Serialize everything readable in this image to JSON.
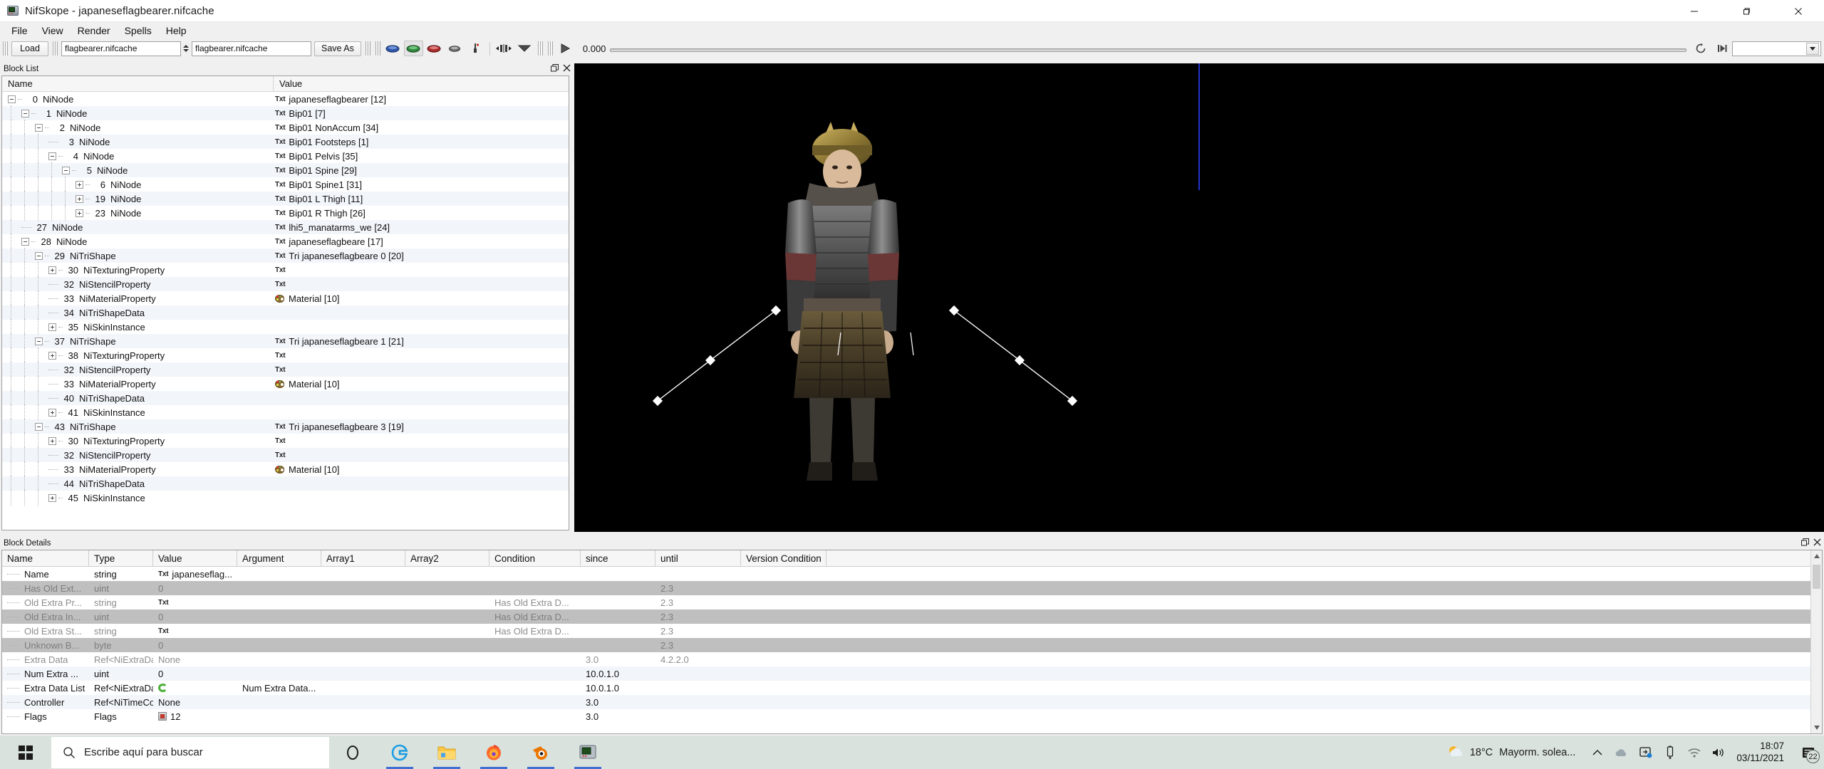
{
  "window": {
    "title": "NifSkope - japaneseflagbearer.nifcache",
    "app_icon": "nifskope-icon",
    "minimize": "minimize-icon",
    "maximize": "maximize-icon",
    "close": "close-icon"
  },
  "menu": {
    "items": [
      "File",
      "View",
      "Render",
      "Spells",
      "Help"
    ]
  },
  "toolbar": {
    "load_label": "Load",
    "source_combo": "flagbearer.nifcache",
    "dest_combo": "flagbearer.nifcache",
    "save_as_label": "Save As",
    "view_icons": [
      "view-blue-icon",
      "view-green-icon",
      "view-red-icon",
      "view-grey-icon",
      "paint-icon"
    ],
    "transform_icon": "move-nodes-icon",
    "dropdown_icon": "chevron-down-icon",
    "play_icon": "play-icon",
    "time_value": "0.000",
    "loop_icon": "loop-icon",
    "frame_icon": "next-frame-icon",
    "anim_combo": ""
  },
  "block_list": {
    "panel_title": "Block List",
    "float_icon": "float-panel-icon",
    "close_icon": "close-panel-icon",
    "columns": [
      "Name",
      "Value"
    ],
    "rows": [
      {
        "depth": 0,
        "toggle": "minus",
        "num": "0",
        "type": "NiNode",
        "badge": "Txt",
        "value": "japaneseflagbearer [12]"
      },
      {
        "depth": 1,
        "toggle": "minus",
        "num": "1",
        "type": "NiNode",
        "badge": "Txt",
        "value": "Bip01 [7]"
      },
      {
        "depth": 2,
        "toggle": "minus",
        "num": "2",
        "type": "NiNode",
        "badge": "Txt",
        "value": "Bip01 NonAccum [34]"
      },
      {
        "depth": 3,
        "toggle": "none",
        "num": "3",
        "type": "NiNode",
        "badge": "Txt",
        "value": "Bip01 Footsteps [1]"
      },
      {
        "depth": 3,
        "toggle": "minus",
        "num": "4",
        "type": "NiNode",
        "badge": "Txt",
        "value": "Bip01 Pelvis [35]"
      },
      {
        "depth": 4,
        "toggle": "minus",
        "num": "5",
        "type": "NiNode",
        "badge": "Txt",
        "value": "Bip01 Spine [29]"
      },
      {
        "depth": 5,
        "toggle": "plus",
        "num": "6",
        "type": "NiNode",
        "badge": "Txt",
        "value": "Bip01 Spine1 [31]"
      },
      {
        "depth": 5,
        "toggle": "plus",
        "num": "19",
        "type": "NiNode",
        "badge": "Txt",
        "value": "Bip01 L Thigh [11]"
      },
      {
        "depth": 5,
        "toggle": "plus",
        "num": "23",
        "type": "NiNode",
        "badge": "Txt",
        "value": "Bip01 R Thigh [26]"
      },
      {
        "depth": 1,
        "toggle": "none",
        "num": "27",
        "type": "NiNode",
        "badge": "Txt",
        "value": "lhi5_manatarms_we [24]"
      },
      {
        "depth": 1,
        "toggle": "minus",
        "num": "28",
        "type": "NiNode",
        "badge": "Txt",
        "value": "japaneseflagbeare [17]"
      },
      {
        "depth": 2,
        "toggle": "minus",
        "num": "29",
        "type": "NiTriShape",
        "badge": "Txt",
        "value": "Tri japaneseflagbeare 0 [20]"
      },
      {
        "depth": 3,
        "toggle": "plus",
        "num": "30",
        "type": "NiTexturingProperty",
        "badge": "Txt",
        "value": ""
      },
      {
        "depth": 3,
        "toggle": "none",
        "num": "32",
        "type": "NiStencilProperty",
        "badge": "Txt",
        "value": ""
      },
      {
        "depth": 3,
        "toggle": "none",
        "num": "33",
        "type": "NiMaterialProperty",
        "badge": "Palette",
        "value": "Material [10]"
      },
      {
        "depth": 3,
        "toggle": "none",
        "num": "34",
        "type": "NiTriShapeData",
        "badge": "",
        "value": ""
      },
      {
        "depth": 3,
        "toggle": "plus",
        "num": "35",
        "type": "NiSkinInstance",
        "badge": "",
        "value": ""
      },
      {
        "depth": 2,
        "toggle": "minus",
        "num": "37",
        "type": "NiTriShape",
        "badge": "Txt",
        "value": "Tri japaneseflagbeare 1 [21]"
      },
      {
        "depth": 3,
        "toggle": "plus",
        "num": "38",
        "type": "NiTexturingProperty",
        "badge": "Txt",
        "value": ""
      },
      {
        "depth": 3,
        "toggle": "none",
        "num": "32",
        "type": "NiStencilProperty",
        "badge": "Txt",
        "value": ""
      },
      {
        "depth": 3,
        "toggle": "none",
        "num": "33",
        "type": "NiMaterialProperty",
        "badge": "Palette",
        "value": "Material [10]"
      },
      {
        "depth": 3,
        "toggle": "none",
        "num": "40",
        "type": "NiTriShapeData",
        "badge": "",
        "value": ""
      },
      {
        "depth": 3,
        "toggle": "plus",
        "num": "41",
        "type": "NiSkinInstance",
        "badge": "",
        "value": ""
      },
      {
        "depth": 2,
        "toggle": "minus",
        "num": "43",
        "type": "NiTriShape",
        "badge": "Txt",
        "value": "Tri japaneseflagbeare 3 [19]"
      },
      {
        "depth": 3,
        "toggle": "plus",
        "num": "30",
        "type": "NiTexturingProperty",
        "badge": "Txt",
        "value": ""
      },
      {
        "depth": 3,
        "toggle": "none",
        "num": "32",
        "type": "NiStencilProperty",
        "badge": "Txt",
        "value": ""
      },
      {
        "depth": 3,
        "toggle": "none",
        "num": "33",
        "type": "NiMaterialProperty",
        "badge": "Palette",
        "value": "Material [10]"
      },
      {
        "depth": 3,
        "toggle": "none",
        "num": "44",
        "type": "NiTriShapeData",
        "badge": "",
        "value": ""
      },
      {
        "depth": 3,
        "toggle": "plus",
        "num": "45",
        "type": "NiSkinInstance",
        "badge": "",
        "value": ""
      }
    ]
  },
  "viewport": {
    "name": "render-viewport",
    "background": "#000000",
    "axis_color": "#2233cc"
  },
  "block_details": {
    "panel_title": "Block Details",
    "float_icon": "float-panel-icon",
    "close_icon": "close-panel-icon",
    "columns": [
      "Name",
      "Type",
      "Value",
      "Argument",
      "Array1",
      "Array2",
      "Condition",
      "since",
      "until",
      "Version Condition"
    ],
    "rows": [
      {
        "style": "normal",
        "name": "Name",
        "type": "string",
        "badge": "Txt",
        "value": "japaneseflag...",
        "argument": "",
        "array1": "",
        "array2": "",
        "condition": "",
        "since": "",
        "until": "",
        "vercond": ""
      },
      {
        "style": "grey",
        "name": "Has Old Ext...",
        "type": "uint",
        "badge": "",
        "value": "0",
        "argument": "",
        "array1": "",
        "array2": "",
        "condition": "",
        "since": "",
        "until": "2.3",
        "vercond": ""
      },
      {
        "style": "dim",
        "name": "Old Extra Pr...",
        "type": "string",
        "badge": "Txt",
        "value": "",
        "argument": "",
        "array1": "",
        "array2": "",
        "condition": "Has Old Extra D...",
        "since": "",
        "until": "2.3",
        "vercond": ""
      },
      {
        "style": "grey",
        "name": "Old Extra In...",
        "type": "uint",
        "badge": "",
        "value": "0",
        "argument": "",
        "array1": "",
        "array2": "",
        "condition": "Has Old Extra D...",
        "since": "",
        "until": "2.3",
        "vercond": ""
      },
      {
        "style": "dim",
        "name": "Old Extra St...",
        "type": "string",
        "badge": "Txt",
        "value": "",
        "argument": "",
        "array1": "",
        "array2": "",
        "condition": "Has Old Extra D...",
        "since": "",
        "until": "2.3",
        "vercond": ""
      },
      {
        "style": "grey",
        "name": "Unknown B...",
        "type": "byte",
        "badge": "",
        "value": "0",
        "argument": "",
        "array1": "",
        "array2": "",
        "condition": "",
        "since": "",
        "until": "2.3",
        "vercond": ""
      },
      {
        "style": "dim",
        "name": "Extra Data",
        "type": "Ref<NiExtraDat...",
        "badge": "",
        "value": "None",
        "argument": "",
        "array1": "",
        "array2": "",
        "condition": "",
        "since": "3.0",
        "until": "4.2.2.0",
        "vercond": ""
      },
      {
        "style": "zebra",
        "name": "Num Extra ...",
        "type": "uint",
        "badge": "",
        "value": "0",
        "argument": "",
        "array1": "",
        "array2": "",
        "condition": "",
        "since": "10.0.1.0",
        "until": "",
        "vercond": ""
      },
      {
        "style": "normal",
        "name": "Extra Data List",
        "type": "Ref<NiExtraDat...",
        "badge": "Refresh",
        "value": "",
        "argument": "Num Extra Data...",
        "array1": "",
        "array2": "",
        "condition": "",
        "since": "10.0.1.0",
        "until": "",
        "vercond": ""
      },
      {
        "style": "zebra",
        "name": "Controller",
        "type": "Ref<NiTimeCo...",
        "badge": "",
        "value": "None",
        "argument": "",
        "array1": "",
        "array2": "",
        "condition": "",
        "since": "3.0",
        "until": "",
        "vercond": ""
      },
      {
        "style": "normal",
        "name": "Flags",
        "type": "Flags",
        "badge": "Flag",
        "value": "12",
        "argument": "",
        "array1": "",
        "array2": "",
        "condition": "",
        "since": "3.0",
        "until": "",
        "vercond": ""
      }
    ]
  },
  "taskbar": {
    "start_icon": "windows-start-icon",
    "search_placeholder": "Escribe aquí para buscar",
    "search_icon": "search-icon",
    "pinned": [
      {
        "name": "cortana-icon",
        "label": "O"
      },
      {
        "name": "internet-explorer-icon",
        "label": "e"
      },
      {
        "name": "file-explorer-icon",
        "label": ""
      },
      {
        "name": "firefox-icon",
        "label": ""
      },
      {
        "name": "blender-icon",
        "label": ""
      },
      {
        "name": "nifskope-taskbar-icon",
        "label": ""
      }
    ],
    "weather_temp": "18°C",
    "weather_desc": "Mayorm. solea...",
    "tray_icons": [
      "chevron-up-icon",
      "onedrive-icon",
      "share-icon",
      "usb-icon",
      "wifi-icon",
      "volume-icon"
    ],
    "time": "18:07",
    "date": "03/11/2021",
    "notification_count": "22",
    "notification_icon": "notifications-icon"
  }
}
